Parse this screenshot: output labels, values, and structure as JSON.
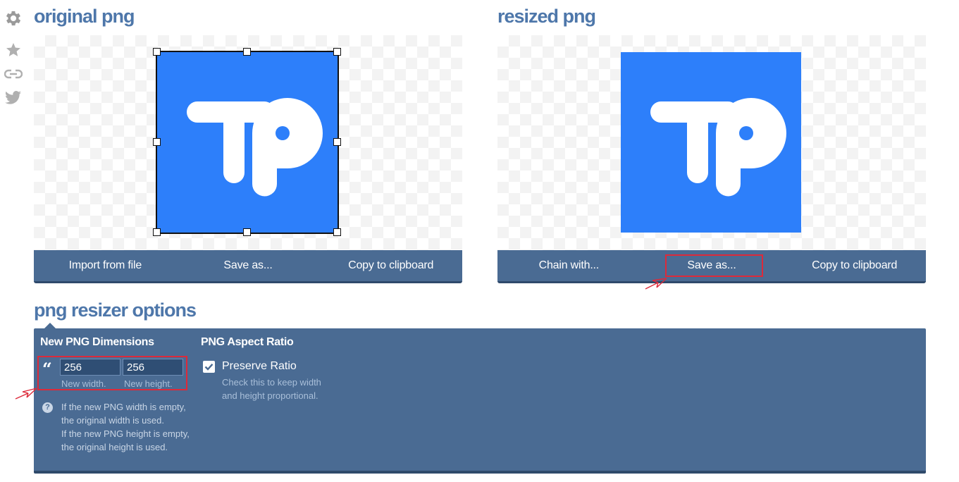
{
  "rail": {
    "icons": [
      "gear-icon",
      "star-icon",
      "link-icon",
      "twitter-icon"
    ]
  },
  "original": {
    "title": "original png",
    "buttons": [
      "Import from file",
      "Save as...",
      "Copy to clipboard"
    ]
  },
  "resized": {
    "title": "resized png",
    "buttons": [
      "Chain with...",
      "Save as...",
      "Copy to clipboard"
    ]
  },
  "options": {
    "title": "png resizer options",
    "dimensions": {
      "heading": "New PNG Dimensions",
      "width_value": "256",
      "height_value": "256",
      "width_label": "New width.",
      "height_label": "New height.",
      "help_lines": [
        "If the new PNG width is empty,",
        "the original width is used.",
        "If the new PNG height is empty,",
        "the original height is used."
      ]
    },
    "aspect": {
      "heading": "PNG Aspect Ratio",
      "checkbox_label": "Preserve Ratio",
      "checked": true,
      "help_lines": [
        "Check this to keep width",
        "and height proportional."
      ]
    }
  },
  "colors": {
    "accent": "#4e77aa",
    "toolbar": "#4a6b93",
    "image_blue": "#2d7ffa",
    "annotation_red": "#dd2a3a"
  }
}
